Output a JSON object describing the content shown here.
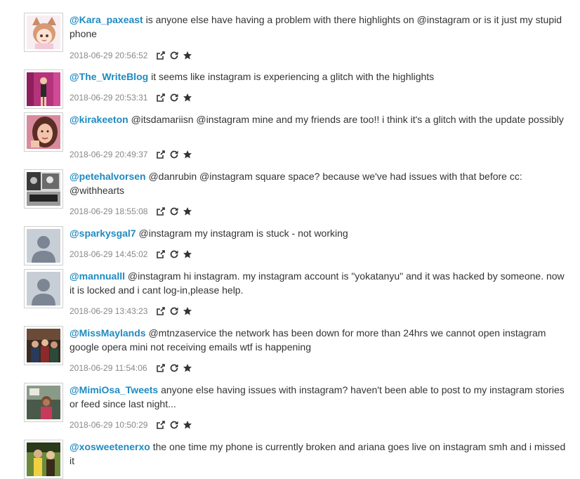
{
  "feed": {
    "items": [
      {
        "handle": "@Kara_paxeast",
        "text": " is anyone else have having a problem with there highlights on @instagram or is it just my stupid phone",
        "timestamp": "2018-06-29 20:56:52",
        "avatar_icon": "anime-character-avatar"
      },
      {
        "handle": "@The_WriteBlog",
        "text": " it seems like instagram is experiencing a glitch with the highlights",
        "timestamp": "2018-06-29 20:53:31",
        "avatar_icon": "person-photo-avatar"
      },
      {
        "handle": "@kirakeeton",
        "text": " @itsdamariisn @instagram mine and my friends are too!! i think it's a glitch with the update possibly",
        "timestamp": "2018-06-29 20:49:37",
        "avatar_icon": "person-photo-avatar"
      },
      {
        "handle": "@petehalvorsen",
        "text": " @danrubin @instagram square space? because we've had issues with that before cc: @withhearts",
        "timestamp": "2018-06-29 18:55:08",
        "avatar_icon": "bw-photo-avatar"
      },
      {
        "handle": "@sparkysgal7",
        "text": " @instagram my instagram is stuck - not working",
        "timestamp": "2018-06-29 14:45:02",
        "avatar_icon": "default-user-avatar"
      },
      {
        "handle": "@mannualll",
        "text": " @instagram hi instagram. my instagram account is \"yokatanyu\" and it was hacked by someone. now it is locked and i cant log-in,please help.",
        "timestamp": "2018-06-29 13:43:23",
        "avatar_icon": "default-user-avatar"
      },
      {
        "handle": "@MissMaylands",
        "text": " @mtnzaservice the network has been down for more than 24hrs we cannot open instagram google opera mini not receiving emails wtf is happening",
        "timestamp": "2018-06-29 11:54:06",
        "avatar_icon": "group-photo-avatar"
      },
      {
        "handle": "@MimiOsa_Tweets",
        "text": " anyone else having issues with instagram? haven't been able to post to my instagram stories or feed since last night...",
        "timestamp": "2018-06-29 10:50:29",
        "avatar_icon": "person-photo-avatar"
      },
      {
        "handle": "@xosweetenerxo",
        "text": " the one time my phone is currently broken and ariana goes live on instagram smh and i missed it",
        "timestamp": "",
        "avatar_icon": "person-photo-avatar"
      }
    ],
    "actions": {
      "share_icon": "share-icon",
      "retweet_icon": "refresh-icon",
      "favorite_icon": "star-icon"
    },
    "colors": {
      "handle": "#1f8ac0",
      "text": "#333333",
      "timestamp": "#888888",
      "icon": "#333333"
    }
  }
}
